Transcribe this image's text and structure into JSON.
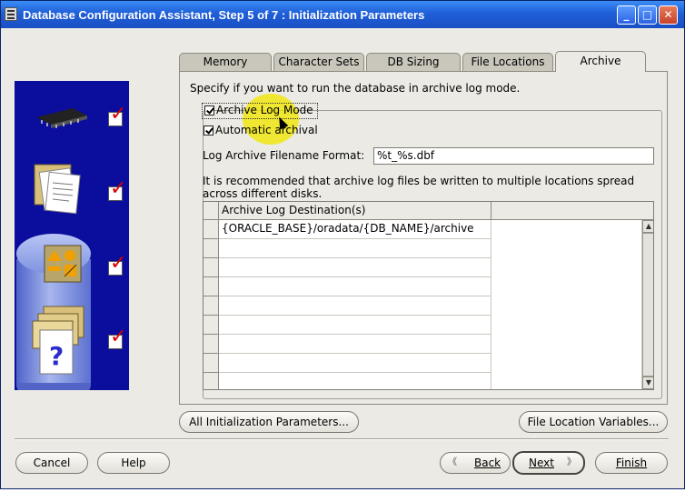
{
  "window": {
    "title": "Database Configuration Assistant, Step 5 of 7 : Initialization Parameters",
    "controls": {
      "minimize": "_",
      "maximize": "□",
      "close": "✕"
    }
  },
  "tabs": [
    {
      "label": "Memory",
      "active": false
    },
    {
      "label": "Character Sets",
      "active": false
    },
    {
      "label": "DB Sizing",
      "active": false
    },
    {
      "label": "File Locations",
      "active": false
    },
    {
      "label": "Archive",
      "active": true
    }
  ],
  "archive": {
    "intro": "Specify if you want to run the database in archive log mode.",
    "archive_log_mode": {
      "label": "Archive Log Mode",
      "checked": true
    },
    "automatic_archival": {
      "label": "Automatic archival",
      "checked": true
    },
    "format_label": "Log Archive Filename Format:",
    "format_value": "%t_%s.dbf",
    "recommend_line1": "It is recommended that archive log files be written to multiple locations spread",
    "recommend_line2": "across different disks.",
    "table": {
      "column_header": "Archive Log Destination(s)",
      "rows": [
        "{ORACLE_BASE}/oradata/{DB_NAME}/archive",
        "",
        "",
        "",
        "",
        "",
        "",
        "",
        "",
        ""
      ]
    }
  },
  "buttons": {
    "all_init_params": "All Initialization Parameters...",
    "file_location_vars": "File Location Variables...",
    "cancel": "Cancel",
    "help": "Help",
    "back": "Back",
    "next": "Next",
    "finish": "Finish"
  },
  "icons": {
    "back_chevron": "《",
    "next_chevron": "》"
  },
  "colors": {
    "titlebar": "#1f5fd8",
    "side_panel": "#0b0d9c",
    "check_red": "#d80000",
    "cursor_highlight": "#f0e600"
  }
}
